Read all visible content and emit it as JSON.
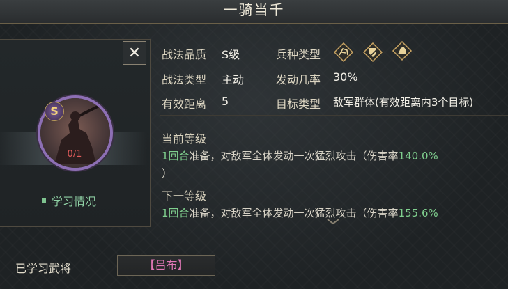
{
  "header": {
    "title": "一骑当千"
  },
  "close_label": "✕",
  "skill": {
    "grade_badge": "S",
    "progress": "0/1",
    "study_label": "学习情况"
  },
  "info": {
    "quality_label": "战法品质",
    "quality_value": "S级",
    "troop_label": "兵种类型",
    "troop_icons": [
      "cavalry-icon",
      "shield-infantry-icon",
      "archer-icon"
    ],
    "type_label": "战法类型",
    "type_value": "主动",
    "rate_label": "发动几率",
    "rate_value": "30%",
    "range_label": "有效距离",
    "range_value": "5",
    "target_label": "目标类型",
    "target_value": "敌军群体(有效距离内3个目标)"
  },
  "current_level": {
    "title": "当前等级",
    "prep": "1回合",
    "text_a": "准备，对敌军全体发动一次猛烈攻击（伤害率",
    "rate": "140.0%",
    "text_b": "）"
  },
  "next_level": {
    "title": "下一等级",
    "prep": "1回合",
    "text_a": "准备，对敌军全体发动一次猛烈攻击（伤害率",
    "rate": "155.6%"
  },
  "learned": {
    "label": "已学习武将",
    "general": "【吕布】"
  },
  "colors": {
    "accent_green": "#7fcf8e",
    "damage_red": "#e05a5a",
    "general_pink": "#e178b7",
    "gold": "#f3d27a"
  }
}
